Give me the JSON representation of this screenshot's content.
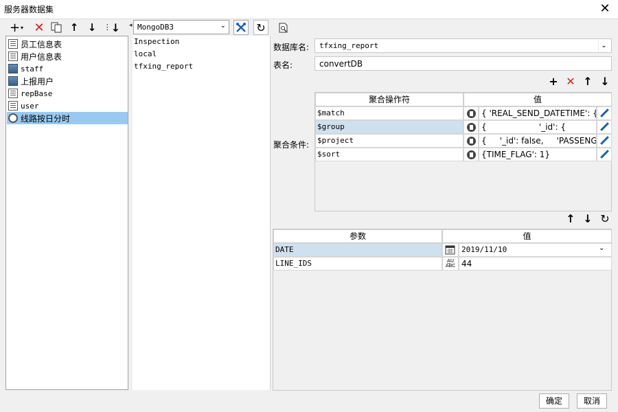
{
  "window": {
    "title": "服务器数据集",
    "close_icon": "close-icon"
  },
  "left_toolbar": {
    "icons": [
      "add-icon",
      "chevron-down-icon",
      "delete-icon",
      "copy-icon",
      "arrow-up-icon",
      "arrow-down-icon",
      "sort-icon"
    ]
  },
  "tree": {
    "items": [
      {
        "label": "员工信息表",
        "icon": "table-icon",
        "selected": false
      },
      {
        "label": "用户信息表",
        "icon": "table-icon",
        "selected": false
      },
      {
        "label": "staff",
        "icon": "database-icon",
        "selected": false
      },
      {
        "label": "上报用户",
        "icon": "database-icon",
        "selected": false
      },
      {
        "label": "repBase",
        "icon": "table-icon",
        "selected": false
      },
      {
        "label": "user",
        "icon": "table-icon",
        "selected": false
      },
      {
        "label": "线路按日分时",
        "icon": "view-icon",
        "selected": true
      }
    ]
  },
  "middle": {
    "db_select": {
      "value": "MongoDB3"
    },
    "toolbar_icons": [
      "tools-icon",
      "refresh-icon",
      "preview-icon"
    ],
    "databases": [
      "Inspection",
      "local",
      "tfxing_report"
    ]
  },
  "right": {
    "db_name_label": "数据库名:",
    "db_name_value": "tfxing_report",
    "table_label": "表名:",
    "table_value": "convertDB",
    "agg_label": "聚合条件:",
    "agg_toolbar_icons": [
      "add-icon",
      "delete-icon",
      "arrow-up-icon",
      "arrow-down-icon"
    ],
    "agg_headers": {
      "operator": "聚合操作符",
      "value": "值"
    },
    "agg_rows": [
      {
        "operator": "$match",
        "value": "{ 'REAL_SEND_DATETIME': {",
        "highlight": false
      },
      {
        "operator": "$group",
        "value": "{                    '_id': {",
        "highlight": true
      },
      {
        "operator": "$project",
        "value": "{     '_id': false,     'PASSENGE",
        "highlight": false
      },
      {
        "operator": "$sort",
        "value": "{TIME_FLAG': 1}",
        "highlight": false
      }
    ],
    "param_toolbar_icons": [
      "arrow-up-icon",
      "arrow-down-icon",
      "refresh-icon"
    ],
    "param_headers": {
      "name": "参数",
      "value": "值"
    },
    "params": [
      {
        "name": "DATE",
        "type_icon": "calendar-icon",
        "value": "2019/11/10",
        "highlight": true
      },
      {
        "name": "LINE_IDS",
        "type_icon": "text-type-icon",
        "value": "44",
        "highlight": false
      }
    ]
  },
  "footer": {
    "ok_label": "确定",
    "cancel_label": "取消"
  }
}
